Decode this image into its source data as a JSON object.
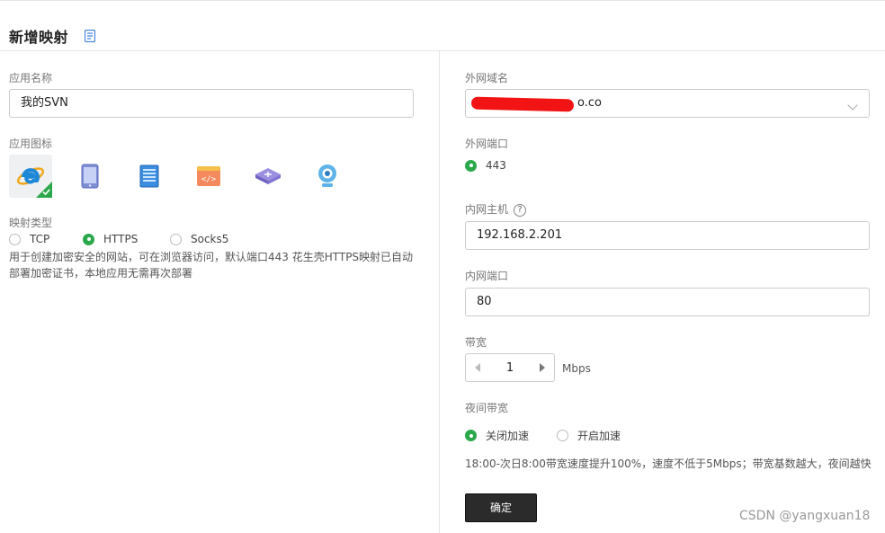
{
  "header": {
    "title": "新增映射",
    "doc_icon": "doc-icon"
  },
  "left": {
    "app_name_label": "应用名称",
    "app_name_value": "我的SVN",
    "app_icon_label": "应用图标",
    "app_icons": [
      "ie-browser-icon",
      "tablet-icon",
      "server-icon",
      "code-window-icon",
      "router-icon",
      "camera-icon"
    ],
    "selected_icon": "ie-browser-icon",
    "mapping_type_label": "映射类型",
    "mapping_types": [
      "TCP",
      "HTTPS",
      "Socks5"
    ],
    "selected_type": "HTTPS",
    "description": "用于创建加密安全的网站，可在浏览器访问，默认端口443 花生壳HTTPS映射已自动部署加密证书，本地应用无需再次部署"
  },
  "right": {
    "domain_label": "外网域名",
    "domain_value_visible": "o.co",
    "external_port_label": "外网端口",
    "external_port_value": "443",
    "internal_host_label": "内网主机",
    "internal_host_value": "192.168.2.201",
    "internal_port_label": "内网端口",
    "internal_port_value": "80",
    "bandwidth_label": "带宽",
    "bandwidth_value": "1",
    "bandwidth_unit": "Mbps",
    "night_bandwidth_label": "夜间带宽",
    "night_options": [
      "关闭加速",
      "开启加速"
    ],
    "night_selected": "关闭加速",
    "night_note": "18:00-次日8:00带宽速度提升100%，速度不低于5Mbps；带宽基数越大，夜间越快",
    "confirm_label": "确定"
  },
  "watermark": "CSDN @yangxuan18",
  "colors": {
    "accent_green": "#2aa84a",
    "button_dark": "#2b2b2b",
    "redaction": "#f21414"
  }
}
